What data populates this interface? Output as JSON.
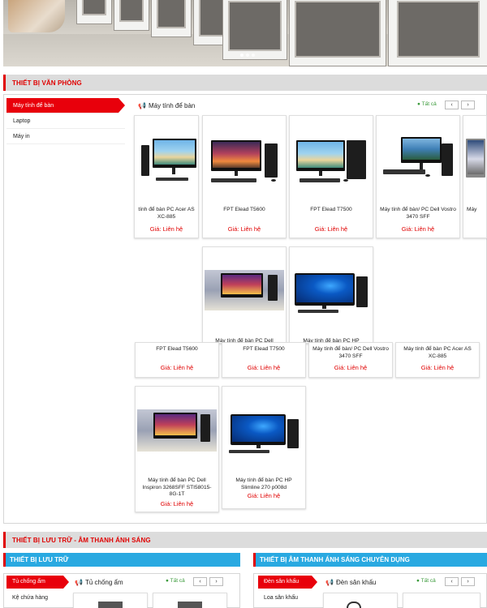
{
  "colors": {
    "accent_red": "#e00000",
    "blue_bar": "#29a9e1",
    "green_link": "#3a9a3a"
  },
  "hero": {
    "slides": 3,
    "active_slide": 1
  },
  "office": {
    "title": "THIẾT BỊ VĂN PHÒNG",
    "categories": [
      "Máy tính để bàn",
      "Laptop",
      "Máy in"
    ],
    "subhead": "Máy tính để bàn",
    "see_all": "Tất cả",
    "prev": "‹",
    "next": "›",
    "products": [
      {
        "name": "tính để bàn PC Acer AS XC-885",
        "price": "Giá: Liên hệ",
        "icon": "desktop-pc-image"
      },
      {
        "name": "FPT Elead T5600",
        "price": "Giá: Liên hệ",
        "icon": "desktop-pc-image"
      },
      {
        "name": "FPT Elead T7500",
        "price": "Giá: Liên hệ",
        "icon": "desktop-pc-image"
      },
      {
        "name": "Máy tính để bàn/ PC Dell Vostro 3470 SFF",
        "price": "Giá: Liên hệ",
        "icon": "desktop-pc-image"
      },
      {
        "name": "Máy",
        "price": "",
        "icon": "desktop-pc-image"
      }
    ],
    "row2_overlay": [
      {
        "name": "Máy tính để bàn PC Dell",
        "icon": "desktop-pc-image"
      },
      {
        "name": "Máy tính để bàn PC HP",
        "icon": "desktop-pc-image"
      }
    ],
    "row2": [
      {
        "name": "FPT Elead T5600",
        "price": "Giá: Liên hệ"
      },
      {
        "name": "FPT Elead T7500",
        "price": "Giá: Liên hệ"
      },
      {
        "name": "Máy tính để bàn/ PC Dell Vostro 3470 SFF",
        "price": "Giá: Liên hệ"
      },
      {
        "name": "Máy tính để bàn PC Acer AS XC-885",
        "price": "Giá: Liên hệ"
      }
    ],
    "row3": [
      {
        "name": "Máy tính để bàn PC Dell Inspiron 3268SFF STI58015-8G-1T",
        "price": "Giá: Liên hệ"
      },
      {
        "name": "Máy tính để bàn PC HP Slimline 270 p008d",
        "price": "Giá: Liên hệ"
      }
    ]
  },
  "storage_av": {
    "title": "THIẾT BỊ LƯU TRỮ - ÂM THANH ÁNH SÁNG",
    "left": {
      "title": "THIẾT BỊ LƯU TRỮ",
      "active_cat": "Tủ chống ẩm",
      "cat2": "Kệ chứa hàng",
      "subhead": "Tủ chống ẩm",
      "see_all": "Tất cả"
    },
    "right": {
      "title": "THIẾT BỊ ÂM THANH ÁNH SÁNG CHUYÊN DỤNG",
      "active_cat": "Đèn sân khấu",
      "cat2": "Loa sân khấu",
      "subhead": "Đèn sân khấu",
      "see_all": "Tất cả"
    }
  }
}
